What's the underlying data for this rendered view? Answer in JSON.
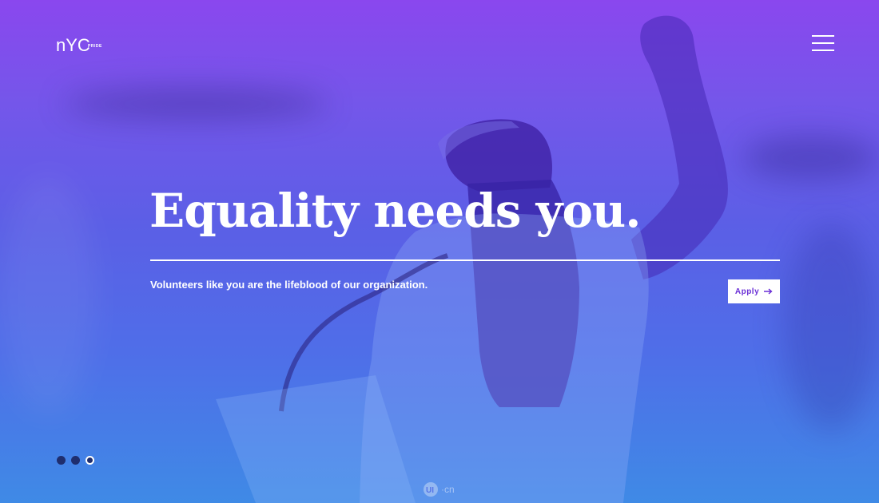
{
  "brand": {
    "logo_text": "nYC",
    "logo_subtext": "PRIDE"
  },
  "nav": {
    "menu_icon": "hamburger-menu-icon"
  },
  "hero": {
    "headline": "Equality needs you.",
    "subtext": "Volunteers like you are the lifeblood of our organization.",
    "apply_label": "Apply",
    "apply_icon": "arrow-right-icon"
  },
  "carousel": {
    "slides": 3,
    "active_index": 3
  },
  "watermark": {
    "logo": "UI",
    "suffix": "·cn"
  },
  "colors": {
    "gradient_top": "#8a47ee",
    "gradient_bottom": "#3f8ae6",
    "button_text": "#6a2fd6",
    "dot": "#1f2e6e"
  }
}
